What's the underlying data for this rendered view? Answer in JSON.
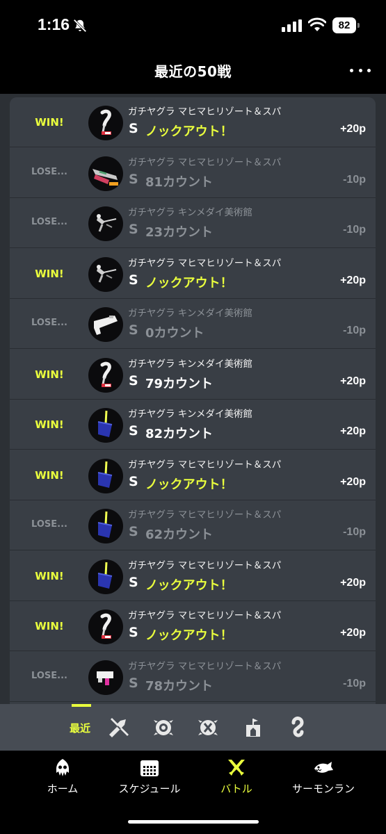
{
  "status_bar": {
    "time": "1:16",
    "battery": "82"
  },
  "header": {
    "title": "最近の50戦"
  },
  "battles": [
    {
      "result": "WIN!",
      "is_win": true,
      "stage": "ガチヤグラ マヒマヒリゾート＆スパ",
      "rank": "S",
      "score": "ノックアウト！",
      "knockout": true,
      "points": "+20p",
      "weapon": "brush-weapon-icon"
    },
    {
      "result": "LOSE...",
      "is_win": false,
      "stage": "ガチヤグラ マヒマヒリゾート＆スパ",
      "rank": "S",
      "score": "81カウント",
      "knockout": false,
      "points": "-10p",
      "weapon": "splatling-weapon-icon"
    },
    {
      "result": "LOSE...",
      "is_win": false,
      "stage": "ガチヤグラ キンメダイ美術館",
      "rank": "S",
      "score": "23カウント",
      "knockout": false,
      "points": "-10p",
      "weapon": "charger-weapon-icon"
    },
    {
      "result": "WIN!",
      "is_win": true,
      "stage": "ガチヤグラ マヒマヒリゾート＆スパ",
      "rank": "S",
      "score": "ノックアウト！",
      "knockout": true,
      "points": "+20p",
      "weapon": "charger-weapon-icon"
    },
    {
      "result": "LOSE...",
      "is_win": false,
      "stage": "ガチヤグラ キンメダイ美術館",
      "rank": "S",
      "score": "0カウント",
      "knockout": false,
      "points": "-10p",
      "weapon": "blaster-weapon-icon"
    },
    {
      "result": "WIN!",
      "is_win": true,
      "stage": "ガチヤグラ キンメダイ美術館",
      "rank": "S",
      "score": "79カウント",
      "knockout": false,
      "points": "+20p",
      "weapon": "brush-weapon-icon"
    },
    {
      "result": "WIN!",
      "is_win": true,
      "stage": "ガチヤグラ キンメダイ美術館",
      "rank": "S",
      "score": "82カウント",
      "knockout": false,
      "points": "+20p",
      "weapon": "bucket-weapon-icon"
    },
    {
      "result": "WIN!",
      "is_win": true,
      "stage": "ガチヤグラ マヒマヒリゾート＆スパ",
      "rank": "S",
      "score": "ノックアウト！",
      "knockout": true,
      "points": "+20p",
      "weapon": "bucket-weapon-icon"
    },
    {
      "result": "LOSE...",
      "is_win": false,
      "stage": "ガチヤグラ マヒマヒリゾート＆スパ",
      "rank": "S",
      "score": "62カウント",
      "knockout": false,
      "points": "-10p",
      "weapon": "bucket-weapon-icon"
    },
    {
      "result": "WIN!",
      "is_win": true,
      "stage": "ガチヤグラ マヒマヒリゾート＆スパ",
      "rank": "S",
      "score": "ノックアウト！",
      "knockout": true,
      "points": "+20p",
      "weapon": "bucket-weapon-icon"
    },
    {
      "result": "WIN!",
      "is_win": true,
      "stage": "ガチヤグラ マヒマヒリゾート＆スパ",
      "rank": "S",
      "score": "ノックアウト！",
      "knockout": true,
      "points": "+20p",
      "weapon": "brush-weapon-icon"
    },
    {
      "result": "LOSE...",
      "is_win": false,
      "stage": "ガチヤグラ マヒマヒリゾート＆スパ",
      "rank": "S",
      "score": "78カウント",
      "knockout": false,
      "points": "-10p",
      "weapon": "pink-shooter-weapon-icon"
    }
  ],
  "filter_bar": {
    "recent_label": "最近",
    "icons": [
      "regular-battle-icon",
      "anarchy-battle-icon",
      "x-battle-icon",
      "event-match-icon",
      "private-battle-icon"
    ]
  },
  "bottom_nav": {
    "items": [
      {
        "label": "ホーム",
        "icon": "squid-icon"
      },
      {
        "label": "スケジュール",
        "icon": "calendar-icon"
      },
      {
        "label": "バトル",
        "icon": "battle-icon",
        "active": true
      },
      {
        "label": "サーモンラン",
        "icon": "salmon-icon"
      }
    ]
  },
  "colors": {
    "accent": "#eaff3d",
    "background": "#2c3035",
    "card": "#393e45",
    "muted": "#8c9197"
  }
}
